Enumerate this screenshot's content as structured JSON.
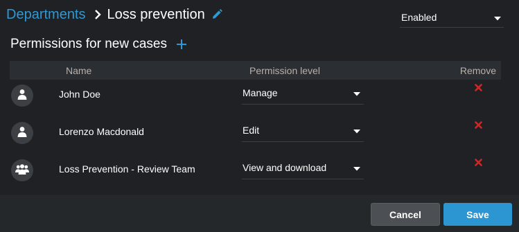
{
  "breadcrumb": {
    "parent": "Departments",
    "current": "Loss prevention"
  },
  "status": {
    "selected": "Enabled"
  },
  "section": {
    "title": "Permissions for new cases"
  },
  "table": {
    "headers": {
      "name": "Name",
      "permission_level": "Permission level",
      "remove": "Remove"
    },
    "rows": [
      {
        "name": "John Doe",
        "type": "user",
        "icon": "user-icon",
        "permission": "Manage"
      },
      {
        "name": "Lorenzo Macdonald",
        "type": "user",
        "icon": "user-icon",
        "permission": "Edit"
      },
      {
        "name": "Loss Prevention - Review Team",
        "type": "group",
        "icon": "group-icon",
        "permission": "View and download"
      }
    ]
  },
  "footer": {
    "cancel_label": "Cancel",
    "save_label": "Save"
  },
  "colors": {
    "background": "#1f2124",
    "accent": "#2b9ad6",
    "remove": "#e02020",
    "header_bg": "#2b2e32",
    "footer_bg": "#25282b",
    "save_button": "#2b96d1",
    "cancel_button": "#4c4f54"
  }
}
